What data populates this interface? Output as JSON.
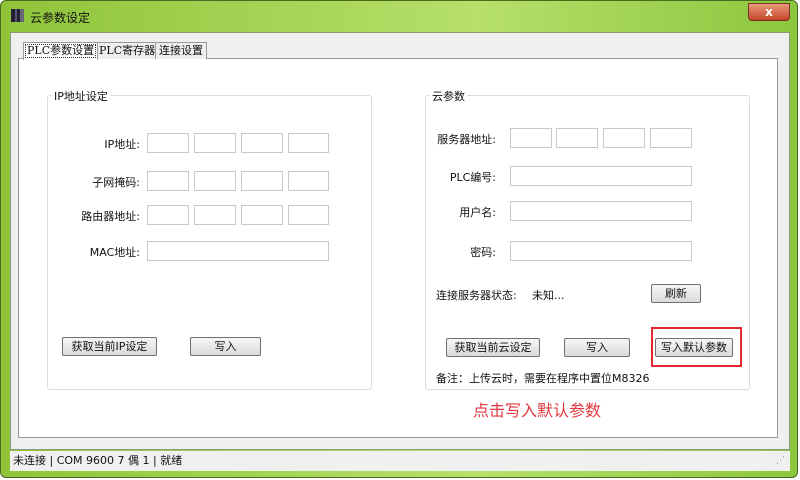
{
  "window": {
    "title": "云参数设定",
    "close": "x"
  },
  "tabs": [
    "PLC参数设置",
    "PLC寄存器",
    "连接设置"
  ],
  "ip_group": {
    "title": "IP地址设定",
    "ip_label": "IP地址:",
    "mask_label": "子网掩码:",
    "gateway_label": "路由器地址:",
    "mac_label": "MAC地址:",
    "get_button": "获取当前IP设定",
    "write_button": "写入"
  },
  "cloud_group": {
    "title": "云参数",
    "server_label": "服务器地址:",
    "plc_id_label": "PLC编号:",
    "user_label": "用户名:",
    "password_label": "密码:",
    "status_label": "连接服务器状态:",
    "status_value": "未知...",
    "refresh_button": "刷新",
    "get_button": "获取当前云设定",
    "write_button": "写入",
    "default_button": "写入默认参数",
    "note": "备注：上传云时，需要在程序中置位M8326"
  },
  "annotation": "点击写入默认参数",
  "statusbar": "未连接 | COM 9600 7 偶 1 | 就绪",
  "colors": {
    "highlight": "#e0282f",
    "title_bar": "#a8d85a"
  }
}
